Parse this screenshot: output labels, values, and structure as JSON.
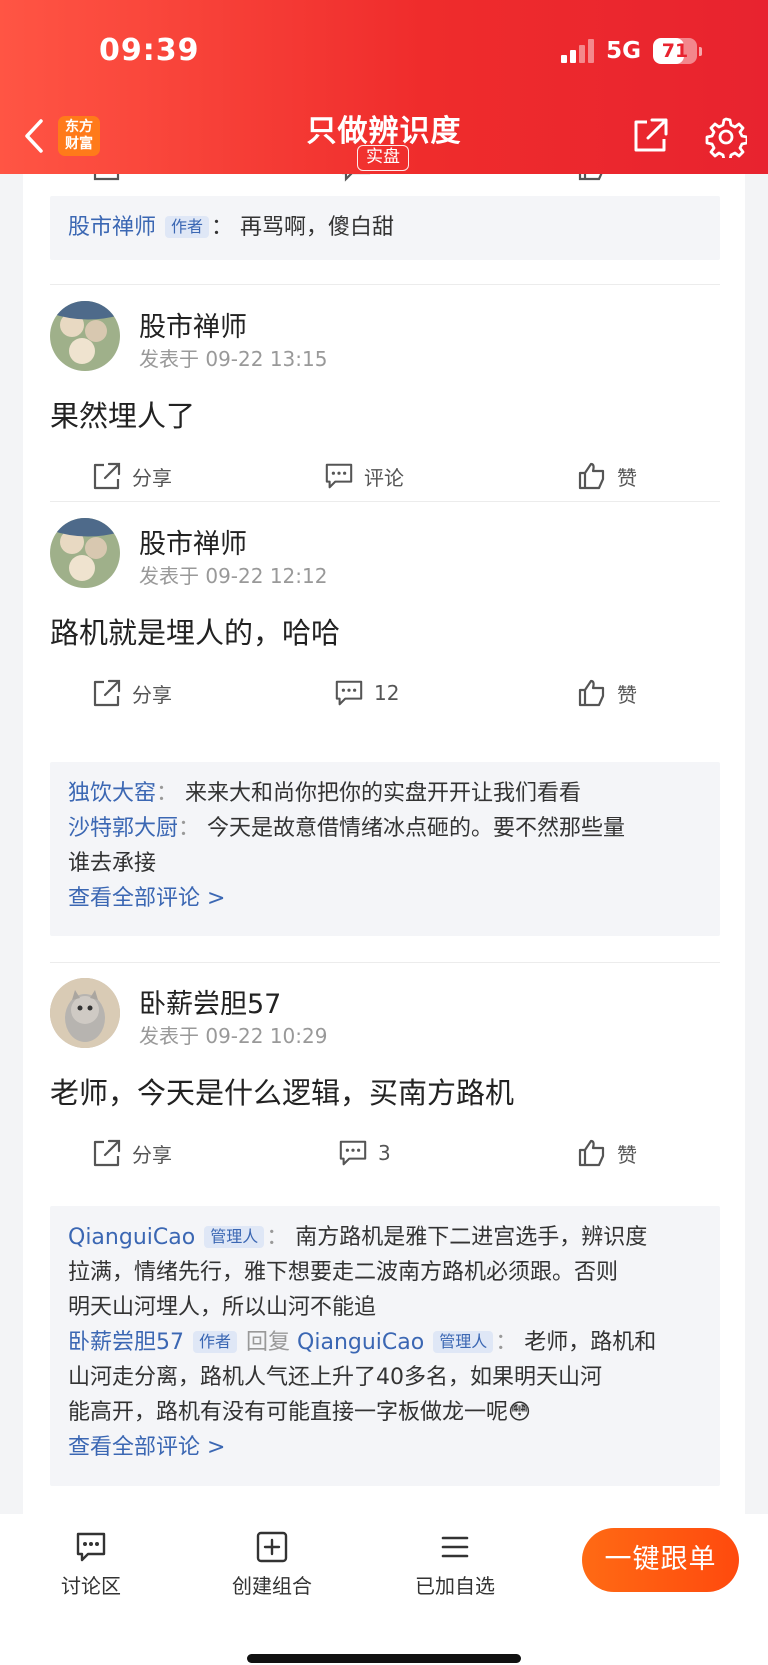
{
  "status_bar": {
    "time": "09:39",
    "network": "5G",
    "battery": "71",
    "battery_level": 0.71
  },
  "nav": {
    "logo_line1": "东方",
    "logo_line2": "财富",
    "title": "只做辨识度",
    "tag": "实盘"
  },
  "top_reply": {
    "user": "股市禅师",
    "role": "作者",
    "sep": "：",
    "text": "再骂啊，傻白甜"
  },
  "posts": [
    {
      "user": "股市禅师",
      "time": "发表于 09-22 13:15",
      "text": "果然埋人了",
      "share": "分享",
      "comment": "评论",
      "like": "赞"
    },
    {
      "user": "股市禅师",
      "time": "发表于 09-22 12:12",
      "text": "路机就是埋人的，哈哈",
      "share": "分享",
      "comment": "12",
      "like": "赞",
      "replies": [
        {
          "user": "独饮大窑",
          "sep": "：",
          "text": "来来大和尚你把你的实盘开开让我们看看"
        },
        {
          "user": "沙特郭大厨",
          "sep": "：",
          "text_line1": "今天是故意借情绪冰点砸的。要不然那些量",
          "text_line2": "谁去承接"
        }
      ],
      "more": "查看全部评论 >"
    },
    {
      "user": "卧薪尝胆57",
      "time": "发表于 09-22 10:29",
      "text": "老师，今天是什么逻辑，买南方路机",
      "share": "分享",
      "comment": "3",
      "like": "赞",
      "replies": [
        {
          "user": "QianguiCao",
          "role": "管理人",
          "sep": "：",
          "text_line1": "南方路机是雅下二进宫选手，辨识度",
          "text_line2": "拉满，情绪先行，雅下想要走二波南方路机必须跟。否则",
          "text_line3": "明天山河埋人，所以山河不能追"
        },
        {
          "user": "卧薪尝胆57",
          "role": "作者",
          "reply_word": "回复",
          "reply_to": "QianguiCao",
          "reply_role": "管理人",
          "sep": "：",
          "text_line1": "老师，路机和",
          "text_line2": "山河走分离，路机人气还上升了40多名，如果明天山河",
          "text_line3": "能高开，路机有没有可能直接一字板做龙一呢😳"
        }
      ],
      "more": "查看全部评论 >"
    }
  ],
  "bottom_bar": {
    "tab1": "讨论区",
    "tab2": "创建组合",
    "tab3": "已加自选",
    "follow_button": "一键跟单"
  },
  "colors": {
    "header_red": "#ef2c2c",
    "link_blue": "#3b67b3",
    "button_orange": "#ff5a10"
  },
  "icons": [
    "back-arrow-icon",
    "share-icon",
    "settings-gear-icon",
    "comment-icon",
    "thumbs-up-icon",
    "plus-box-icon",
    "list-icon",
    "chat-bubble-icon"
  ]
}
